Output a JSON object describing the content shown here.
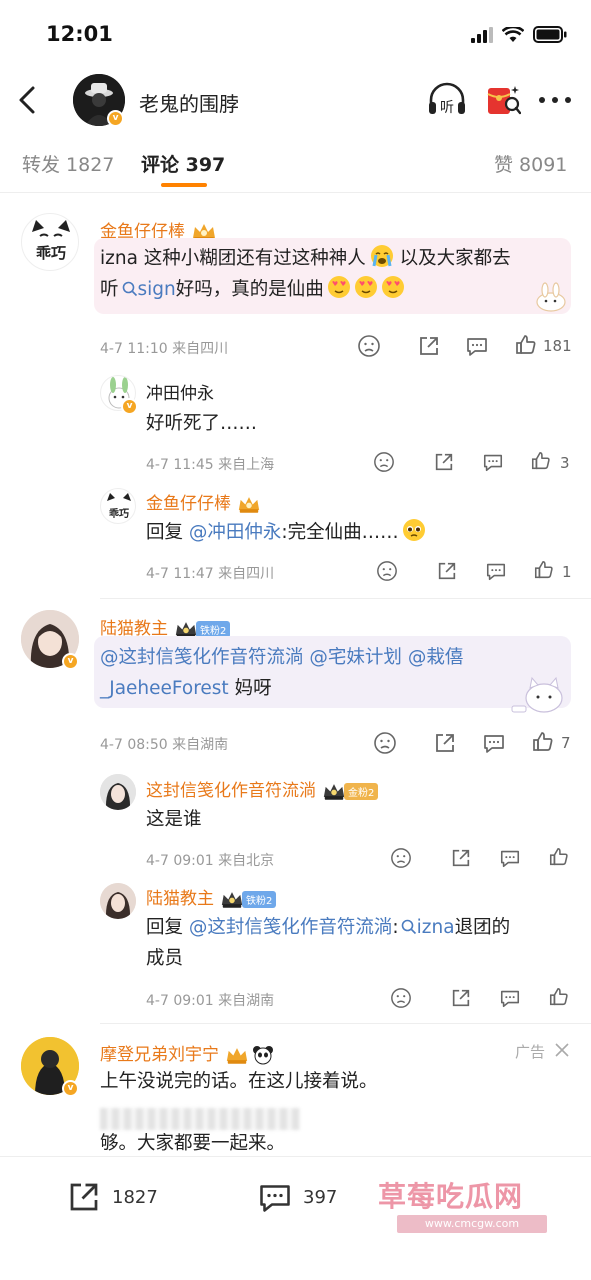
{
  "status": {
    "time": "12:01"
  },
  "nav": {
    "title": "老鬼的围脖",
    "listen_label": "听"
  },
  "tabs": {
    "repost": "转发 1827",
    "comments": "评论 397",
    "likes": "赞 8091"
  },
  "comments": [
    {
      "user": "金鱼仔仔棒",
      "text_a": "izna 这种小糊团还有过这种神人",
      "text_b": " 以及大家都去",
      "text_c": "听",
      "link": "sign",
      "text_d": "好吗，真的是仙曲",
      "meta": "4-7 11:10  来自四川",
      "likes": "181",
      "avatar_text": "乖巧",
      "replies": [
        {
          "user": "冲田仲永",
          "text": "好听死了……",
          "meta": "4-7 11:45  来自上海",
          "likes": "3"
        },
        {
          "user": "金鱼仔仔棒",
          "reply_prefix": "回复 ",
          "mention": "@冲田仲永",
          "text": ":完全仙曲……",
          "meta": "4-7 11:47  来自四川",
          "likes": "1"
        }
      ]
    },
    {
      "user": "陆猫教主",
      "fan_badge": "铁粉2",
      "mention1": "@这封信笺化作音符流淌",
      "mention2": "@宅妹计划",
      "mention3": "@栽僖",
      "mention4": "_JaeheeForest",
      "text_end": " 妈呀",
      "meta": "4-7 08:50  来自湖南",
      "likes": "7",
      "replies": [
        {
          "user": "这封信笺化作音符流淌",
          "fan_badge": "金粉2",
          "text": "这是谁",
          "meta": "4-7 09:01  来自北京"
        },
        {
          "user": "陆猫教主",
          "fan_badge": "铁粉2",
          "reply_prefix": "回复 ",
          "mention": "@这封信笺化作音符流淌",
          "colon": ":",
          "link": "izna",
          "text": "退团的",
          "text2": "成员",
          "meta": "4-7 09:01  来自湖南"
        }
      ]
    },
    {
      "user": "摩登兄弟刘宇宁",
      "ad_label": "广告",
      "text": "上午没说完的话。在这儿接着说。",
      "text_tail": "够。大家都要一起来。"
    }
  ],
  "bottom": {
    "repost": "1827",
    "comment": "397"
  },
  "watermark": {
    "main": "草莓吃瓜网",
    "sub": "www.cmcgw.com"
  },
  "colors": {
    "accent": "#ff8200",
    "username": "#e8791a",
    "link": "#4a7bbf"
  }
}
